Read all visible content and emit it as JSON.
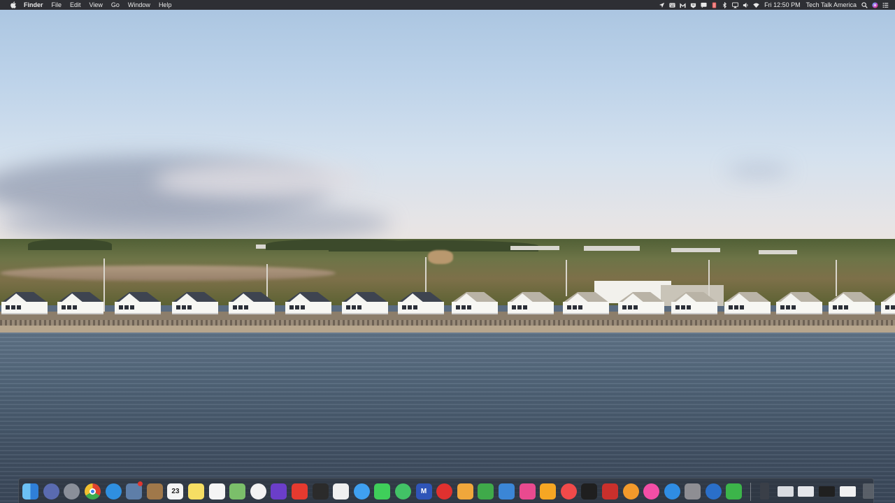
{
  "menubar": {
    "app_name": "Finder",
    "menus": [
      "File",
      "Edit",
      "View",
      "Go",
      "Window",
      "Help"
    ],
    "clock": "Fri 12:50 PM",
    "user": "Tech Talk America",
    "status_icons": [
      "location-arrow-icon",
      "keyboard-icon",
      "malwarebytes-icon",
      "drive-icon",
      "notification-icon",
      "battery-indicator-icon",
      "bluetooth-icon",
      "airplay-icon",
      "volume-icon",
      "wifi-icon"
    ]
  },
  "dock": {
    "calendar_day": "23",
    "apps": [
      {
        "name": "finder",
        "color": "#3a8ee6",
        "glyph": ""
      },
      {
        "name": "launchpad",
        "color": "#5a6bb0",
        "glyph": ""
      },
      {
        "name": "rocket",
        "color": "#8a8f99",
        "glyph": ""
      },
      {
        "name": "chrome",
        "color": "#e8c13a",
        "glyph": ""
      },
      {
        "name": "safari",
        "color": "#2f8fe0",
        "glyph": ""
      },
      {
        "name": "preview",
        "color": "#5e7ea8",
        "glyph": ""
      },
      {
        "name": "notebook",
        "color": "#a0784a",
        "glyph": ""
      },
      {
        "name": "calendar",
        "color": "#f4f4f4",
        "glyph": ""
      },
      {
        "name": "notes",
        "color": "#f6de63",
        "glyph": ""
      },
      {
        "name": "reminders",
        "color": "#f5f5f5",
        "glyph": ""
      },
      {
        "name": "maps",
        "color": "#7bbf6a",
        "glyph": ""
      },
      {
        "name": "photos",
        "color": "#f2f2f2",
        "glyph": ""
      },
      {
        "name": "imovie",
        "color": "#6b3ec9",
        "glyph": ""
      },
      {
        "name": "youtube",
        "color": "#e53a2f",
        "glyph": ""
      },
      {
        "name": "final-cut",
        "color": "#2b2b2b",
        "glyph": ""
      },
      {
        "name": "screenshot",
        "color": "#f0f0f0",
        "glyph": ""
      },
      {
        "name": "messages-blue",
        "color": "#3fa0f0",
        "glyph": ""
      },
      {
        "name": "messages",
        "color": "#3fcf5a",
        "glyph": ""
      },
      {
        "name": "spotify",
        "color": "#42c266",
        "glyph": ""
      },
      {
        "name": "malwarebytes",
        "color": "#2f55b8",
        "glyph": "M"
      },
      {
        "name": "dots-app",
        "color": "#e0312f",
        "glyph": ""
      },
      {
        "name": "pages",
        "color": "#f0a73b",
        "glyph": ""
      },
      {
        "name": "numbers",
        "color": "#3faa4a",
        "glyph": ""
      },
      {
        "name": "keynote",
        "color": "#3b86d6",
        "glyph": ""
      },
      {
        "name": "color-picker",
        "color": "#e94a8f",
        "glyph": ""
      },
      {
        "name": "home",
        "color": "#f5a623",
        "glyph": ""
      },
      {
        "name": "news",
        "color": "#f04a4a",
        "glyph": ""
      },
      {
        "name": "stocks",
        "color": "#1f1f1f",
        "glyph": ""
      },
      {
        "name": "photo-booth",
        "color": "#c9302c",
        "glyph": ""
      },
      {
        "name": "books",
        "color": "#f39a2b",
        "glyph": ""
      },
      {
        "name": "itunes",
        "color": "#f34ea6",
        "glyph": ""
      },
      {
        "name": "app-store",
        "color": "#2f8de4",
        "glyph": ""
      },
      {
        "name": "system-preferences",
        "color": "#8e8e93",
        "glyph": ""
      },
      {
        "name": "quicktime",
        "color": "#2a6fc9",
        "glyph": ""
      },
      {
        "name": "camtasia",
        "color": "#3cb54a",
        "glyph": ""
      }
    ],
    "right_items": [
      {
        "name": "phone-device",
        "color": "#3a3f48"
      },
      {
        "name": "window-thumb-1",
        "color": "#d8dbe0"
      },
      {
        "name": "window-thumb-2",
        "color": "#e4e6ea"
      },
      {
        "name": "window-thumb-3",
        "color": "#202020"
      },
      {
        "name": "window-thumb-4",
        "color": "#f0f0f0"
      },
      {
        "name": "trash",
        "color": "#6b7078"
      }
    ]
  }
}
